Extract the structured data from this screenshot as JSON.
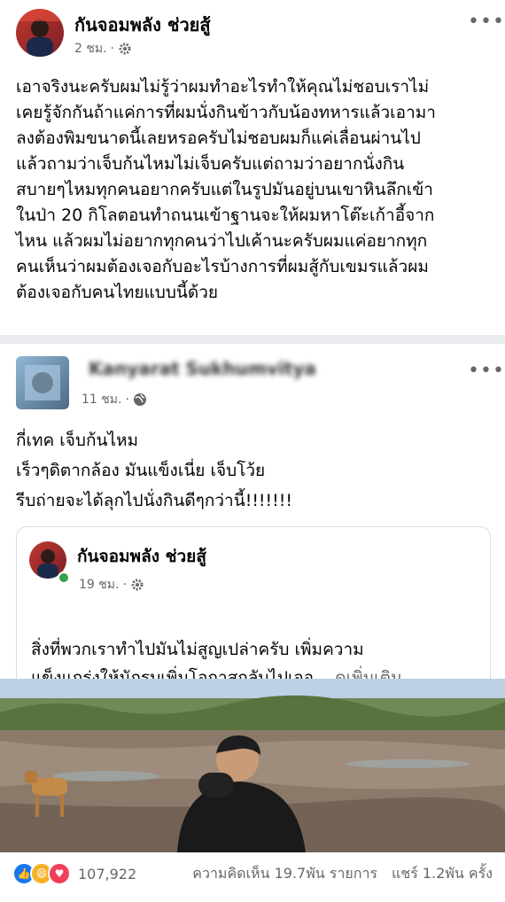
{
  "post1": {
    "author": "กันจอมพลัง ช่วยสู้",
    "time": "2 ชม.",
    "text": "เอาจริงนะครับผมไม่รู้ว่าผมทำอะไรทำให้คุณไม่ชอบเราไม่\nเคยรู้จักกันถ้าแค่การที่ผมนั่งกินข้าวกับน้องทหารแล้วเอามา\nลงต้องพิมขนาดนี้เลยหรอครับไม่ชอบผมก็แค่เลื่อนผ่านไป\nแล้วถามว่าเจ็บก้นไหมไม่เจ็บครับแต่ถามว่าอยากนั่งกิน\nสบายๆไหมทุกคนอยากครับแต่ในรูปมันอยู่บนเขาหินลึกเข้า\nในป่า 20 กิโลตอนทำถนนเข้าฐานจะให้ผมหาโต๊ะเก้าอี้จาก\nไหน แล้วผมไม่อยากทุกคนว่าไปเค้านะครับผมแค่อยากทุก\nคนเห็นว่าผมต้องเจอกับอะไรบ้างการที่ผมสู้กับเขมรแล้วผม\nต้องเจอกับคนไทยแบบนี้ด้วย"
  },
  "post2": {
    "author_blurred": "Kanyarat Sukhumvitya",
    "time": "11 ชม.",
    "text": "กี่เทค เจ็บก้นไหม\nเร็วๆดิตากล้อง มันแข็งเนี่ย เจ็บโว้ย\nรีบถ่ายจะได้ลุกไปนั่งกินดีๆกว่านี้!!!!!!!"
  },
  "shared": {
    "author": "กันจอมพลัง ช่วยสู้",
    "time": "19 ชม.",
    "text": "สิ่งที่พวกเราทำไปมันไม่สูญเปล่าครับ เพิ่มความ\nแข็งแกร่งให้นักรบเพิ่มโอกาสกลับไปเจอ...",
    "see_more": "ดูเพิ่มเติม"
  },
  "stats": {
    "reactions": "107,922",
    "comments": "ความคิดเห็น 19.7พัน รายการ",
    "shares": "แชร์ 1.2พัน ครั้ง"
  },
  "icons": {
    "more": "more-dots-icon",
    "privacy_friends": "gear-icon",
    "privacy_public": "globe-icon"
  },
  "colors": {
    "like": "#1877f2",
    "haha": "#f7b125",
    "love": "#f33e58"
  }
}
